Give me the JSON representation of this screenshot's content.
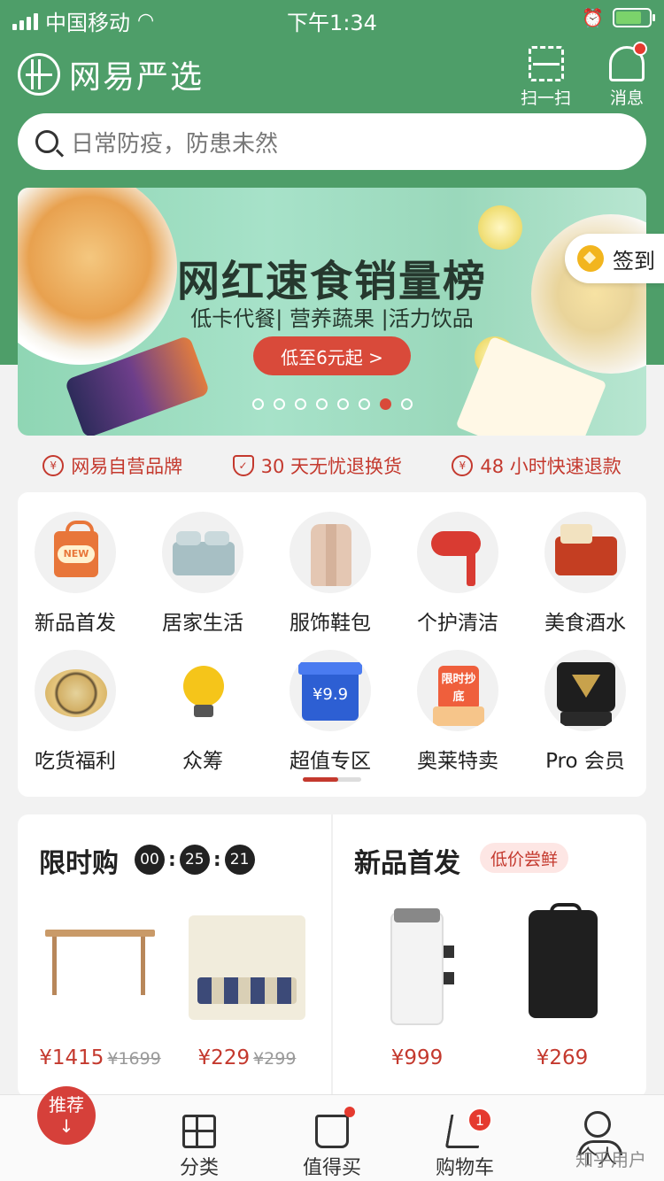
{
  "status_bar": {
    "carrier": "中国移动",
    "time": "下午1:34"
  },
  "header": {
    "app_name": "网易严选",
    "scan_label": "扫一扫",
    "messages_label": "消息"
  },
  "search": {
    "placeholder": "日常防疫，防患未然"
  },
  "banner": {
    "title": "网红速食销量榜",
    "subtitle": "低卡代餐| 营养蔬果 |活力饮品",
    "button": "低至6元起 >",
    "slide_count": 8,
    "active_slide": 7
  },
  "signin": {
    "label": "签到"
  },
  "promises": [
    {
      "icon": "yen-circle-icon",
      "text": "网易自营品牌"
    },
    {
      "icon": "shield-check-icon",
      "text": "30 天无忧退换货"
    },
    {
      "icon": "refund-icon",
      "text": "48 小时快速退款"
    }
  ],
  "categories": [
    {
      "label": "新品首发"
    },
    {
      "label": "居家生活"
    },
    {
      "label": "服饰鞋包"
    },
    {
      "label": "个护清洁"
    },
    {
      "label": "美食酒水"
    },
    {
      "label": "吃货福利"
    },
    {
      "label": "众筹"
    },
    {
      "label": "超值专区",
      "badge": "¥9.9"
    },
    {
      "label": "奥莱特卖",
      "badge": "限时抄底"
    },
    {
      "label": "Pro 会员"
    }
  ],
  "flash_sale": {
    "title": "限时购",
    "countdown": [
      "00",
      "25",
      "21"
    ],
    "products": [
      {
        "price": "¥1415",
        "original": "¥1699"
      },
      {
        "price": "¥229",
        "original": "¥299"
      }
    ]
  },
  "new_arrivals": {
    "title": "新品首发",
    "tag": "低价尝鲜",
    "products": [
      {
        "price": "¥999"
      },
      {
        "price": "¥269"
      }
    ]
  },
  "tabbar": {
    "items": [
      {
        "label": "推荐"
      },
      {
        "label": "分类"
      },
      {
        "label": "值得买"
      },
      {
        "label": "购物车"
      },
      {
        "label": "个人"
      }
    ],
    "cart_count": "1"
  },
  "watermark": "知乎用户",
  "colors": {
    "brand_green": "#4e9e69",
    "accent_red": "#c4392e"
  }
}
